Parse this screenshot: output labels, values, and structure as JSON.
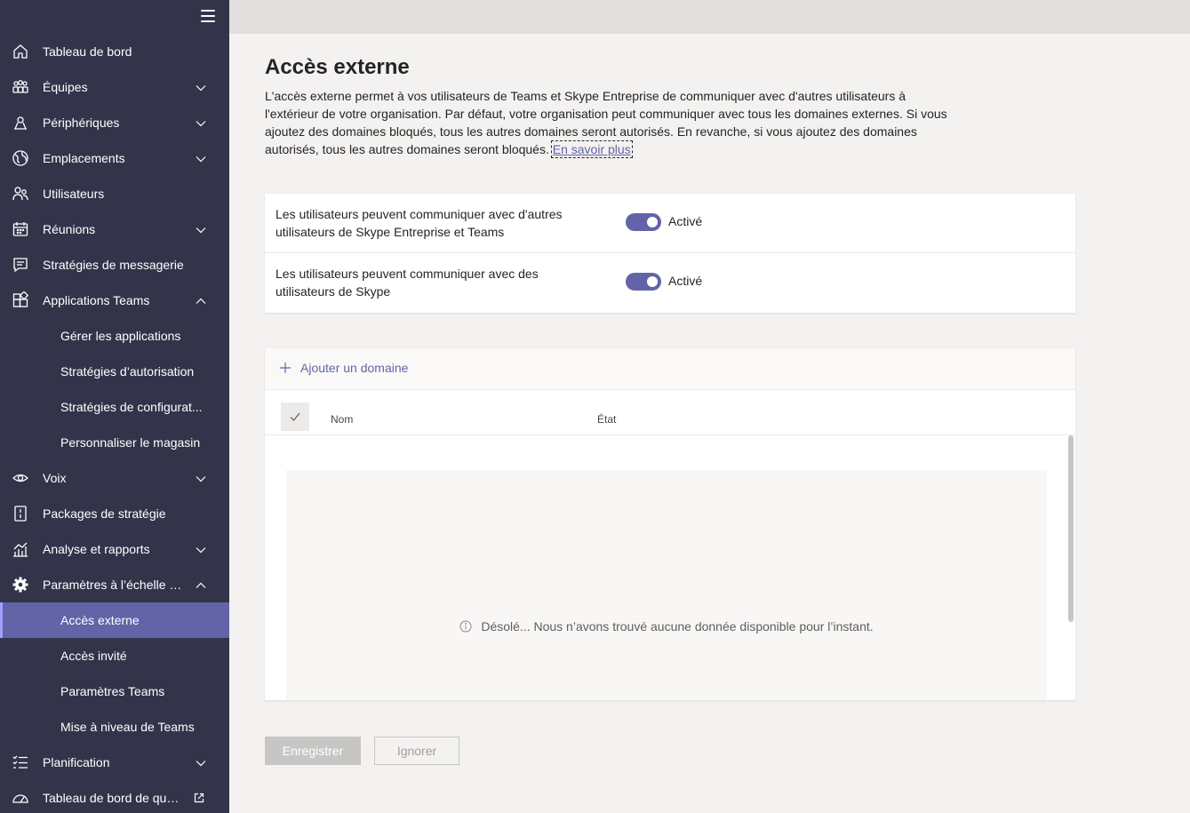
{
  "sidebar": {
    "items": [
      {
        "label": "Tableau de bord",
        "icon": "home-icon"
      },
      {
        "label": "Équipes",
        "icon": "teams-icon"
      },
      {
        "label": "Périphériques",
        "icon": "devices-icon"
      },
      {
        "label": "Emplacements",
        "icon": "globe-icon"
      },
      {
        "label": "Utilisateurs",
        "icon": "users-icon"
      },
      {
        "label": "Réunions",
        "icon": "calendar-icon"
      },
      {
        "label": "Stratégies de messagerie",
        "icon": "chat-icon"
      },
      {
        "label": "Applications Teams",
        "icon": "apps-icon"
      },
      {
        "label": "Gérer les applications"
      },
      {
        "label": "Stratégies d’autorisation"
      },
      {
        "label": "Stratégies de configurat..."
      },
      {
        "label": "Personnaliser le magasin"
      },
      {
        "label": "Voix",
        "icon": "voicemail-icon"
      },
      {
        "label": "Packages de stratégie",
        "icon": "package-icon"
      },
      {
        "label": "Analyse et rapports",
        "icon": "analytics-icon"
      },
      {
        "label": "Paramètres à l’échelle d...",
        "icon": "settings-icon"
      },
      {
        "label": "Accès externe"
      },
      {
        "label": "Accès invité"
      },
      {
        "label": "Paramètres Teams"
      },
      {
        "label": "Mise à niveau de Teams"
      },
      {
        "label": "Planification",
        "icon": "planning-icon"
      },
      {
        "label": "Tableau de bord de qual...",
        "icon": "gauge-icon"
      }
    ]
  },
  "page": {
    "title": "Accès externe",
    "description": "L'accès externe permet à vos utilisateurs de Teams et Skype Entreprise de communiquer avec d'autres utilisateurs à l'extérieur de votre organisation. Par défaut, votre organisation peut communiquer avec tous les domaines externes. Si vous ajoutez des domaines bloqués, tous les autres domaines seront autorisés. En revanche, si vous ajoutez des domaines autorisés, tous les autres domaines seront bloqués.",
    "learn_more": "En savoir plus"
  },
  "settings": [
    {
      "text": "Les utilisateurs peuvent communiquer avec d'autres utilisateurs de Skype Entreprise et Teams",
      "state": "Activé"
    },
    {
      "text": "Les utilisateurs peuvent communiquer avec des utilisateurs de Skype",
      "state": "Activé"
    }
  ],
  "domains": {
    "add_label": "Ajouter un domaine",
    "col_name": "Nom",
    "col_state": "État",
    "empty_message": "Désolé... Nous n’avons trouvé aucune donnée disponible pour l’instant."
  },
  "buttons": {
    "save": "Enregistrer",
    "ignore": "Ignorer"
  },
  "colors": {
    "sidebar_bg": "#33344a",
    "accent": "#6264a7"
  }
}
